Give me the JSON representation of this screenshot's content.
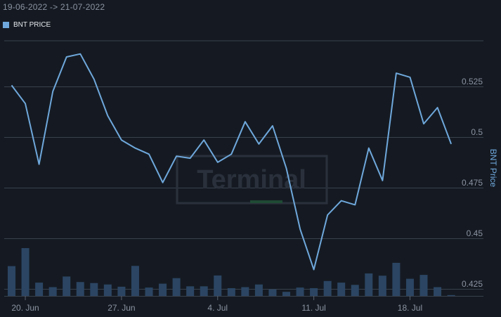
{
  "header": {
    "date_range": "19-06-2022 -> 21-07-2022"
  },
  "legend": {
    "label": "BNT PRICE",
    "color": "#6fa8dc"
  },
  "watermark": {
    "text": "Terminal"
  },
  "colors": {
    "background": "#151a22",
    "grid": "#3a414c",
    "line": "#6fa8dc",
    "volume_bar": "#2b4563",
    "watermark": "#2a313c",
    "watermark_accent": "#1f4a34"
  },
  "chart_data": {
    "type": "line",
    "title": "",
    "ylabel": "BNT Price",
    "ylim": [
      0.4215,
      0.5475
    ],
    "yticks": [
      0.425,
      0.45,
      0.475,
      0.5,
      0.525
    ],
    "ytick_labels": [
      "0.425",
      "0.45",
      "0.475",
      "0.5",
      "0.525"
    ],
    "xticks": [
      {
        "index": 1,
        "label": "20. Jun"
      },
      {
        "index": 8,
        "label": "27. Jun"
      },
      {
        "index": 15,
        "label": "4. Jul"
      },
      {
        "index": 22,
        "label": "11. Jul"
      },
      {
        "index": 29,
        "label": "18. Jul"
      }
    ],
    "series": [
      {
        "name": "BNT PRICE",
        "values": [
          0.5255,
          0.5165,
          0.4865,
          0.5225,
          0.5395,
          0.541,
          0.5285,
          0.5105,
          0.4985,
          0.4945,
          0.4915,
          0.4775,
          0.4905,
          0.4895,
          0.4985,
          0.4875,
          0.4915,
          0.5075,
          0.4965,
          0.5055,
          0.4845,
          0.4545,
          0.4345,
          0.4615,
          0.4685,
          0.4665,
          0.4945,
          0.4785,
          0.5315,
          0.5295,
          0.5065,
          0.5145,
          0.4965
        ]
      }
    ],
    "volume": [
      0.0146,
      0.0234,
      0.0065,
      0.0043,
      0.0095,
      0.0068,
      0.0063,
      0.0056,
      0.0045,
      0.0147,
      0.0041,
      0.006,
      0.0087,
      0.0047,
      0.0047,
      0.01,
      0.0038,
      0.0043,
      0.0056,
      0.0032,
      0.002,
      0.0041,
      0.0038,
      0.0073,
      0.0065,
      0.0054,
      0.011,
      0.0099,
      0.0162,
      0.0084,
      0.0103,
      0.0043,
      0.0004
    ]
  }
}
